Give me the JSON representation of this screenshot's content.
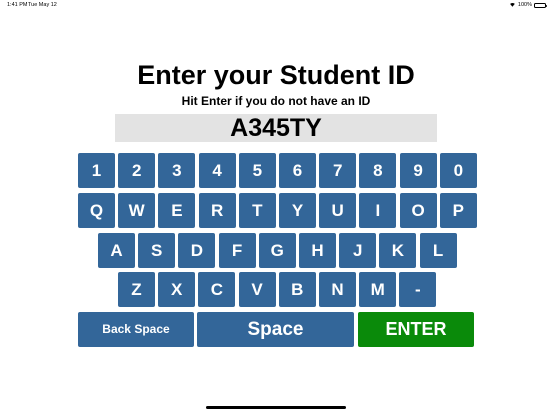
{
  "status": {
    "time": "1:41 PM",
    "date": "Tue May 12",
    "battery_percent": "100%",
    "battery_level": 1.0
  },
  "header": {
    "title": "Enter your Student ID",
    "subtitle": "Hit Enter if you do not have an ID"
  },
  "id_input": {
    "value": "A345TY"
  },
  "keyboard": {
    "row1": [
      "1",
      "2",
      "3",
      "4",
      "5",
      "6",
      "7",
      "8",
      "9",
      "0"
    ],
    "row2": [
      "Q",
      "W",
      "E",
      "R",
      "T",
      "Y",
      "U",
      "I",
      "O",
      "P"
    ],
    "row3": [
      "A",
      "S",
      "D",
      "F",
      "G",
      "H",
      "J",
      "K",
      "L"
    ],
    "row4": [
      "Z",
      "X",
      "C",
      "V",
      "B",
      "N",
      "M",
      "-"
    ],
    "backspace_label": "Back Space",
    "space_label": "Space",
    "enter_label": "ENTER"
  },
  "colors": {
    "key": "#336699",
    "enter": "#0a8a0a",
    "field": "#e3e3e3"
  }
}
